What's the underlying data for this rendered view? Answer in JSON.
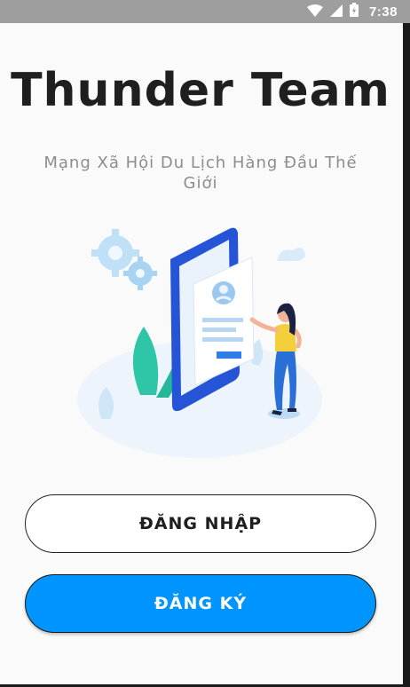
{
  "status_bar": {
    "time": "7:38",
    "icons": [
      "wifi-icon",
      "signal-icon",
      "battery-charging-icon"
    ]
  },
  "app": {
    "title": "Thunder Team",
    "subtitle": "Mạng Xã Hội Du Lịch Hàng Đầu Thế Giới",
    "illustration": "person-tapping-phone-profile-illustration"
  },
  "buttons": {
    "login_label": "ĐĂNG NHẬP",
    "register_label": "ĐĂNG KÝ"
  },
  "colors": {
    "primary": "#0094ff",
    "title_text": "#1f1f1f",
    "subtitle_text": "#8d8d8d",
    "status_bar": "#9e9e9e"
  }
}
